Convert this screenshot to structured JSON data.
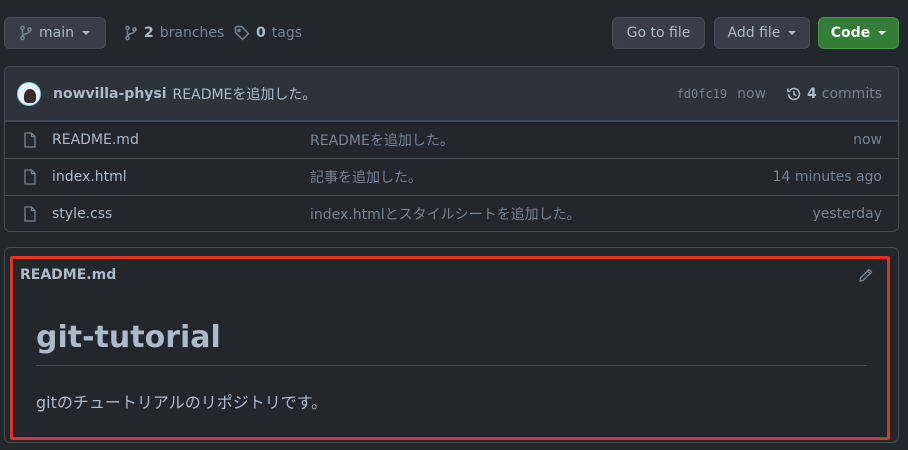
{
  "branch_selector": {
    "label": "main"
  },
  "branches": {
    "count": "2",
    "label": "branches"
  },
  "tags": {
    "count": "0",
    "label": "tags"
  },
  "actions": {
    "go_to_file": "Go to file",
    "add_file": "Add file",
    "code": "Code"
  },
  "latest_commit": {
    "author": "nowvilla-physi",
    "message": "READMEを追加した。",
    "sha": "fd0fc19",
    "time": "now",
    "commits_count": "4",
    "commits_label": "commits"
  },
  "files": [
    {
      "name": "README.md",
      "message": "READMEを追加した。",
      "age": "now"
    },
    {
      "name": "index.html",
      "message": "記事を追加した。",
      "age": "14 minutes ago"
    },
    {
      "name": "style.css",
      "message": "index.htmlとスタイルシートを追加した。",
      "age": "yesterday"
    }
  ],
  "readme": {
    "filename": "README.md",
    "title": "git-tutorial",
    "body": "gitのチュートリアルのリポジトリです。"
  },
  "colors": {
    "background": "#22272e",
    "code_button": "#347d39",
    "highlight": "#e0321f"
  },
  "icons": [
    "branch-icon",
    "tag-icon",
    "history-icon",
    "file-icon",
    "pencil-icon",
    "caret-down-icon"
  ]
}
